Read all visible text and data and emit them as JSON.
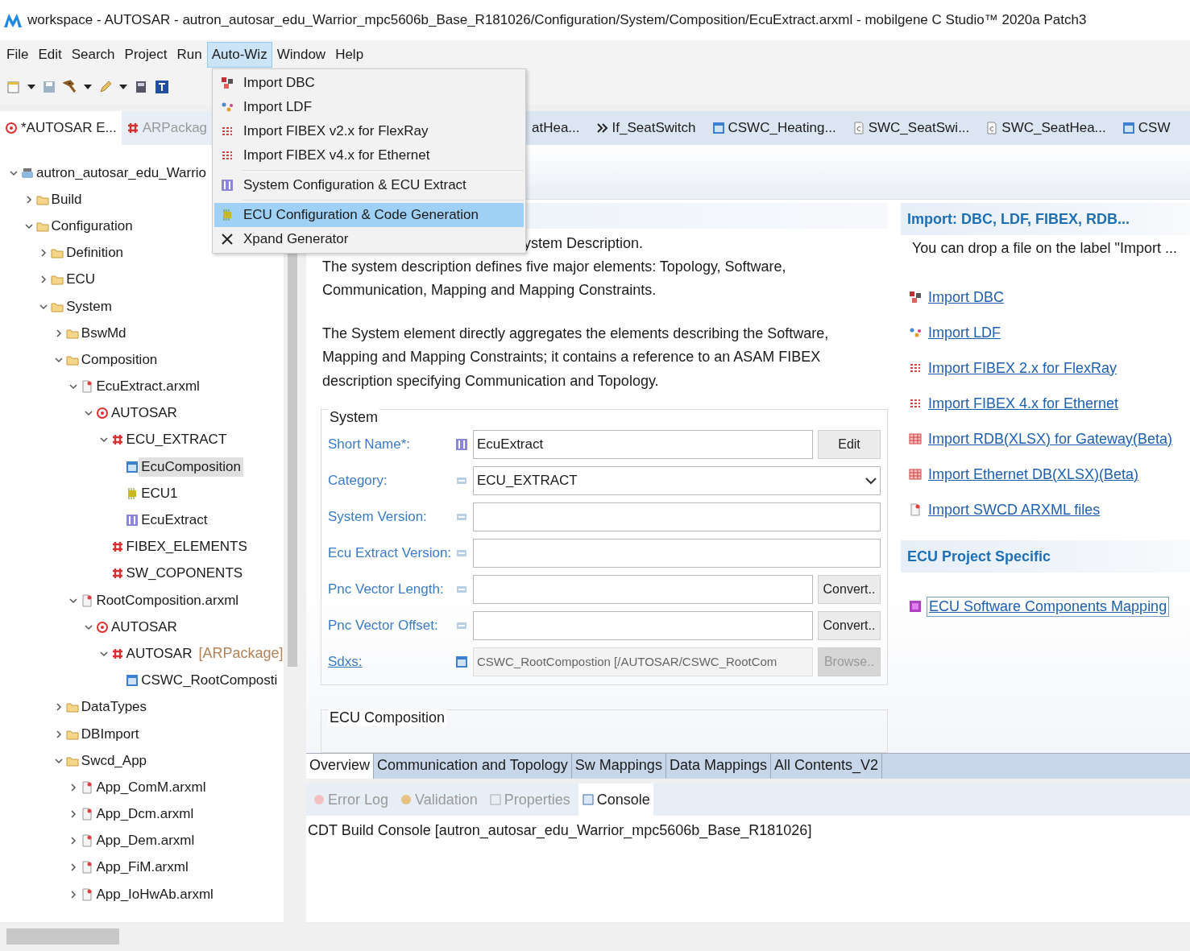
{
  "window": {
    "title": "workspace - AUTOSAR - autron_autosar_edu_Warrior_mpc5606b_Base_R181026/Configuration/System/Composition/EcuExtract.arxml - mobilgene C Studio™ 2020a Patch3"
  },
  "menu_bar": [
    {
      "label": "File",
      "selected": false
    },
    {
      "label": "Edit",
      "selected": false
    },
    {
      "label": "Search",
      "selected": false
    },
    {
      "label": "Project",
      "selected": false
    },
    {
      "label": "Run",
      "selected": false
    },
    {
      "label": "Auto-Wiz",
      "selected": true
    },
    {
      "label": "Window",
      "selected": false
    },
    {
      "label": "Help",
      "selected": false
    }
  ],
  "dropdown_menu": {
    "groups": [
      [
        {
          "label": "Import DBC",
          "kind": "dbc",
          "selected": false
        },
        {
          "label": "Import LDF",
          "kind": "ldf",
          "selected": false
        },
        {
          "label": "Import FIBEX v2.x for FlexRay",
          "kind": "fibex",
          "selected": false
        },
        {
          "label": "Import FIBEX v4.x for Ethernet",
          "kind": "fibex",
          "selected": false
        }
      ],
      [
        {
          "label": "System Configuration & ECU Extract",
          "kind": "system",
          "selected": false
        }
      ],
      [
        {
          "label": "ECU Configuration & Code Generation",
          "kind": "ecu",
          "selected": true
        },
        {
          "label": "Xpand Generator",
          "kind": "xpand",
          "selected": false
        }
      ]
    ]
  },
  "explorer": {
    "tabs": [
      {
        "label": "*AUTOSAR E...",
        "selected": true
      },
      {
        "label": "ARPackag",
        "selected": false
      }
    ],
    "tree": [
      {
        "label": "autron_autosar_edu_Warrio",
        "kind": "project",
        "expanded": true,
        "selected": false,
        "children": [
          {
            "label": "Build",
            "kind": "folder",
            "expanded": false,
            "selected": false
          },
          {
            "label": "Configuration",
            "kind": "folder",
            "expanded": true,
            "selected": false,
            "children": [
              {
                "label": "Definition",
                "kind": "folder",
                "expanded": false,
                "selected": false
              },
              {
                "label": "ECU",
                "kind": "folder",
                "expanded": false,
                "selected": false
              },
              {
                "label": "System",
                "kind": "folder",
                "expanded": true,
                "selected": false,
                "children": [
                  {
                    "label": "BswMd",
                    "kind": "folder",
                    "expanded": false,
                    "selected": false
                  },
                  {
                    "label": "Composition",
                    "kind": "folder",
                    "expanded": true,
                    "selected": false,
                    "children": [
                      {
                        "label": "EcuExtract.arxml",
                        "kind": "file",
                        "expanded": true,
                        "selected": false,
                        "children": [
                          {
                            "label": "AUTOSAR",
                            "kind": "autosar",
                            "expanded": true,
                            "selected": false,
                            "children": [
                              {
                                "label": "ECU_EXTRACT",
                                "kind": "package",
                                "expanded": true,
                                "selected": false,
                                "children": [
                                  {
                                    "label": "EcuComposition",
                                    "kind": "composition",
                                    "selected": true
                                  },
                                  {
                                    "label": "ECU1",
                                    "kind": "ecu",
                                    "selected": false
                                  },
                                  {
                                    "label": "EcuExtract",
                                    "kind": "system",
                                    "selected": false
                                  }
                                ]
                              },
                              {
                                "label": "FIBEX_ELEMENTS",
                                "kind": "package",
                                "selected": false
                              },
                              {
                                "label": "SW_COPONENTS",
                                "kind": "package",
                                "selected": false
                              }
                            ]
                          }
                        ]
                      },
                      {
                        "label": "RootComposition.arxml",
                        "kind": "file",
                        "expanded": true,
                        "selected": false,
                        "children": [
                          {
                            "label": "AUTOSAR",
                            "kind": "autosar",
                            "expanded": true,
                            "selected": false,
                            "children": [
                              {
                                "label": "AUTOSAR",
                                "suffix": "[ARPackage]",
                                "kind": "package",
                                "expanded": true,
                                "selected": false,
                                "children": [
                                  {
                                    "label": "CSWC_RootComposti",
                                    "kind": "composition",
                                    "selected": false
                                  }
                                ]
                              }
                            ]
                          }
                        ]
                      }
                    ]
                  },
                  {
                    "label": "DataTypes",
                    "kind": "folder",
                    "expanded": false,
                    "selected": false
                  },
                  {
                    "label": "DBImport",
                    "kind": "folder",
                    "expanded": false,
                    "selected": false
                  },
                  {
                    "label": "Swcd_App",
                    "kind": "folder",
                    "expanded": true,
                    "selected": false,
                    "children": [
                      {
                        "label": "App_ComM.arxml",
                        "kind": "file",
                        "expanded": false,
                        "selected": false
                      },
                      {
                        "label": "App_Dcm.arxml",
                        "kind": "file",
                        "expanded": false,
                        "selected": false
                      },
                      {
                        "label": "App_Dem.arxml",
                        "kind": "file",
                        "expanded": false,
                        "selected": false
                      },
                      {
                        "label": "App_FiM.arxml",
                        "kind": "file",
                        "expanded": false,
                        "selected": false
                      },
                      {
                        "label": "App_IoHwAb.arxml",
                        "kind": "file",
                        "expanded": false,
                        "selected": false
                      }
                    ]
                  }
                ]
              }
            ]
          }
        ]
      }
    ]
  },
  "editor_tabs": [
    {
      "label": "atHea...",
      "selected": false
    },
    {
      "label": "If_SeatSwitch",
      "kind": "interface",
      "selected": false
    },
    {
      "label": "CSWC_Heating...",
      "kind": "composition",
      "selected": false
    },
    {
      "label": "SWC_SeatSwi...",
      "kind": "swc",
      "selected": false
    },
    {
      "label": "SWC_SeatHea...",
      "kind": "swc",
      "selected": false
    },
    {
      "label": "CSW",
      "kind": "composition",
      "selected": false
    }
  ],
  "overview": {
    "intro": "ystem Description.",
    "paragraphs": [
      "The system description defines five major elements: Topology, Software, Communication, Mapping and Mapping Constraints.",
      "The System element directly aggregates the elements describing the Software, Mapping and Mapping Constraints; it contains a reference to an ASAM FIBEX description specifying Communication and Topology."
    ],
    "system_group": {
      "title": "System",
      "fields": [
        {
          "label": "Short Name*:",
          "kind": "text",
          "value": "EcuExtract",
          "button": "Edit"
        },
        {
          "label": "Category:",
          "kind": "dropdown",
          "value": "ECU_EXTRACT"
        },
        {
          "label": "System Version:",
          "kind": "text"
        },
        {
          "label": "Ecu Extract Version:",
          "kind": "text"
        },
        {
          "label": "Pnc Vector Length:",
          "kind": "text",
          "button": "Convert.."
        },
        {
          "label": "Pnc Vector Offset:",
          "kind": "text",
          "button": "Convert.."
        },
        {
          "label": "Sdxs:",
          "kind": "link",
          "value": "CSWC_RootCompostion [/AUTOSAR/CSWC_RootCom",
          "button": "Browse.."
        }
      ]
    },
    "composition_group": {
      "title": "ECU Composition"
    },
    "import_section": {
      "title": "Import: DBC, LDF, FIBEX, RDB...",
      "hint": "You can drop a file on the label \"Import ...",
      "links": [
        {
          "label": "Import DBC",
          "kind": "dbc"
        },
        {
          "label": "Import LDF",
          "kind": "ldf"
        },
        {
          "label": "Import FIBEX 2.x for FlexRay",
          "kind": "fibex"
        },
        {
          "label": "Import FIBEX 4.x for Ethernet",
          "kind": "fibex"
        },
        {
          "label": "Import RDB(XLSX) for Gateway(Beta)",
          "kind": "table"
        },
        {
          "label": "Import Ethernet DB(XLSX)(Beta)",
          "kind": "table"
        },
        {
          "label": "Import SWCD ARXML files",
          "kind": "file"
        }
      ]
    },
    "project_section": {
      "title": "ECU Project Specific",
      "links": [
        {
          "label": "ECU Software Components Mapping",
          "kind": "mapping"
        }
      ]
    }
  },
  "page_tabs": [
    {
      "label": "Overview",
      "selected": true
    },
    {
      "label": "Communication and Topology",
      "selected": false
    },
    {
      "label": "Sw Mappings",
      "selected": false
    },
    {
      "label": "Data Mappings",
      "selected": false
    },
    {
      "label": "All Contents_V2",
      "selected": false
    }
  ],
  "bottom_view": {
    "tabs": [
      {
        "label": "Error Log",
        "kind": "log",
        "selected": false
      },
      {
        "label": "Validation",
        "kind": "validation",
        "selected": false
      },
      {
        "label": "Properties",
        "kind": "properties",
        "selected": false
      },
      {
        "label": "Console",
        "kind": "console",
        "selected": true
      }
    ],
    "console_line": "CDT Build Console [autron_autosar_edu_Warrior_mpc5606b_Base_R181026]"
  }
}
